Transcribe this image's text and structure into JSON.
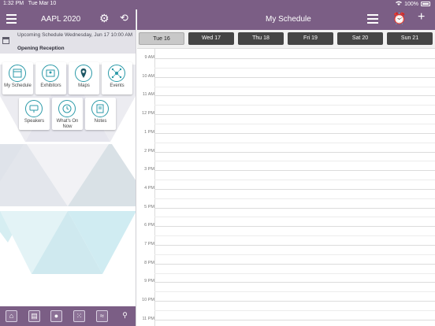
{
  "status_bar": {
    "time": "1:32 PM",
    "date": "Tue Mar 10",
    "wifi_icon": "wifi-icon",
    "battery": "100%"
  },
  "left_header": {
    "title": "AAPL 2020",
    "menu_icon": "hamburger-icon",
    "settings_icon": "gear-icon",
    "sync_icon": "refresh-icon"
  },
  "upcoming": {
    "text": "Upcoming Schedule Wednesday, Jun 17 10:00 AM",
    "event": "Opening Reception"
  },
  "tiles": [
    {
      "label": "My Schedule",
      "icon": "calendar-icon"
    },
    {
      "label": "Exhibitors",
      "icon": "exhibitors-icon"
    },
    {
      "label": "Maps",
      "icon": "map-pin-icon"
    },
    {
      "label": "Events",
      "icon": "network-icon"
    },
    {
      "label": "Speakers",
      "icon": "speakers-icon"
    },
    {
      "label": "What's On Now",
      "icon": "clock-icon"
    },
    {
      "label": "Notes",
      "icon": "notes-icon"
    }
  ],
  "tabbar": [
    {
      "icon": "home-icon",
      "glyph": "⌂"
    },
    {
      "icon": "exhibitors-icon",
      "glyph": "▤"
    },
    {
      "icon": "map-pin-icon",
      "glyph": "●"
    },
    {
      "icon": "grid-icon",
      "glyph": "⁙"
    },
    {
      "icon": "chart-icon",
      "glyph": "≈"
    },
    {
      "icon": "search-icon",
      "glyph": "⚲"
    }
  ],
  "right_header": {
    "title": "My Schedule",
    "list_icon": "list-icon",
    "alarm_icon": "alarm-clock-icon",
    "add_icon": "plus-icon"
  },
  "days": [
    {
      "label": "Tue 16",
      "selected": true
    },
    {
      "label": "Wed 17",
      "selected": false
    },
    {
      "label": "Thu 18",
      "selected": false
    },
    {
      "label": "Fri 19",
      "selected": false
    },
    {
      "label": "Sat 20",
      "selected": false
    },
    {
      "label": "Sun 21",
      "selected": false
    }
  ],
  "times": [
    "9 AM",
    "10 AM",
    "11 AM",
    "12 PM",
    "1 PM",
    "2 PM",
    "3 PM",
    "4 PM",
    "5 PM",
    "6 PM",
    "7 PM",
    "8 PM",
    "9 PM",
    "10 PM",
    "11 PM"
  ],
  "colors": {
    "header": "#7b5e85",
    "day_button": "#454545",
    "day_selected": "#c8c8c8",
    "accent": "#2b9aa8"
  }
}
